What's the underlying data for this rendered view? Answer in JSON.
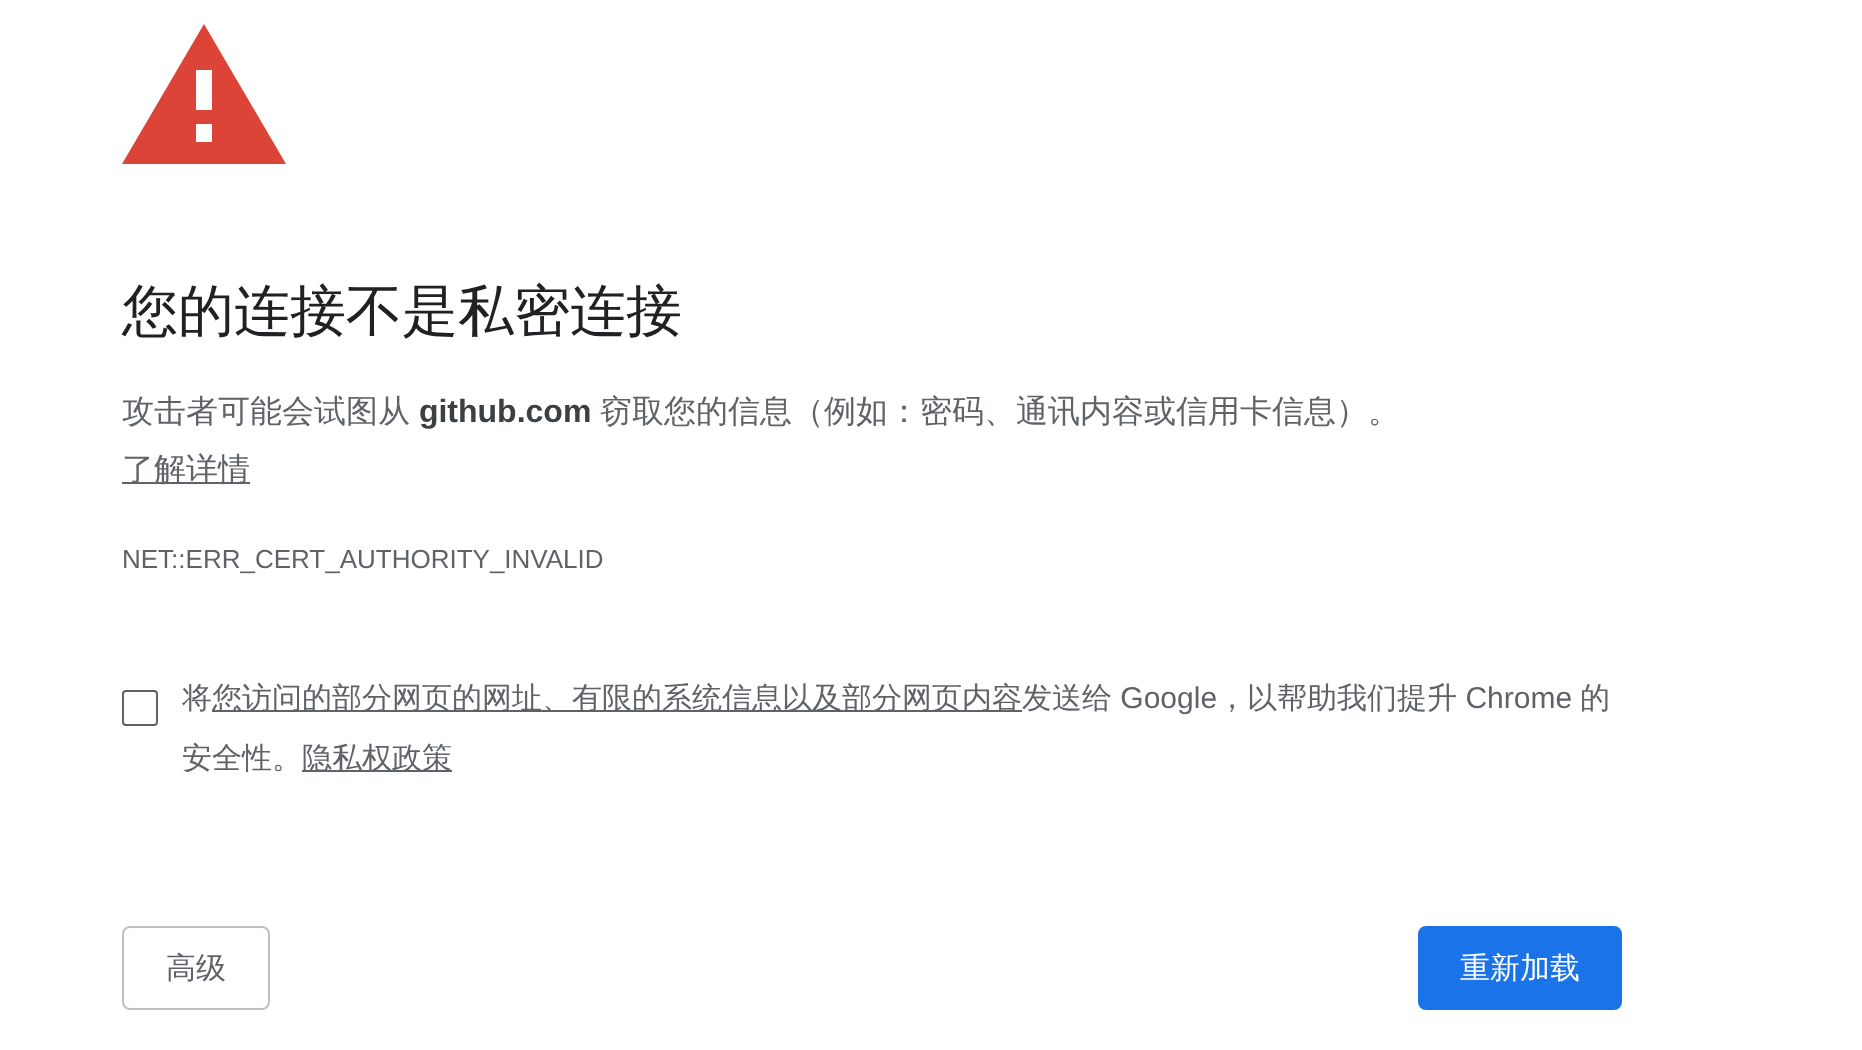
{
  "heading": "您的连接不是私密连接",
  "description": "攻击者可能会试图从 **github.com** 窃取您的信息（例如：密码、通讯内容或信用卡信息）。",
  "learn_more_link": "了解详情",
  "error_code": "NET::ERR_CERT_AUTHORITY_INVALID",
  "report_option": {
    "checked": false,
    "prefix": "将",
    "data_link": "您访问的部分网页的网址、有限的系统信息以及部分网页内容",
    "middle": "发送给 Google，以帮助我们提升 Chrome 的安全性。",
    "privacy_link": "隐私权政策"
  },
  "buttons": [
    {
      "kind": "secondary",
      "label": "高级"
    },
    {
      "kind": "primary",
      "label": "重新加载"
    }
  ]
}
